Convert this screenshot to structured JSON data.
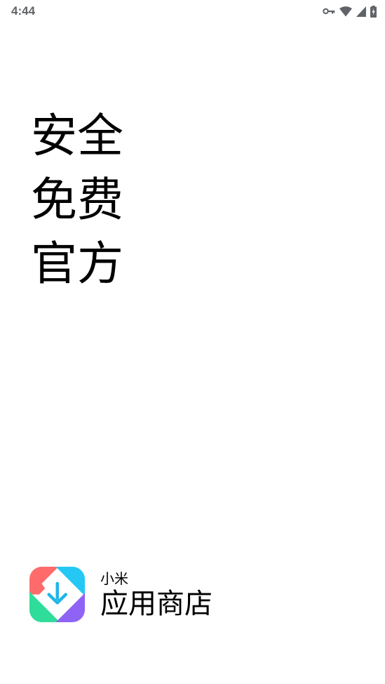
{
  "status_bar": {
    "time": "4:44",
    "icons": [
      "vpn-key-icon",
      "wifi-icon",
      "cellular-signal-icon",
      "battery-charging-icon"
    ],
    "icon_color": "#5f6368"
  },
  "slogan": {
    "lines": [
      "安全",
      "免费",
      "官方"
    ]
  },
  "brand": {
    "subtitle": "小米",
    "name": "应用商店",
    "logo_colors": {
      "top_left": "#ff6b6b",
      "top_right": "#25c8f5",
      "bottom_left": "#2fdc9a",
      "bottom_right": "#8f63f5",
      "arrow": "#1fb6e8"
    }
  }
}
